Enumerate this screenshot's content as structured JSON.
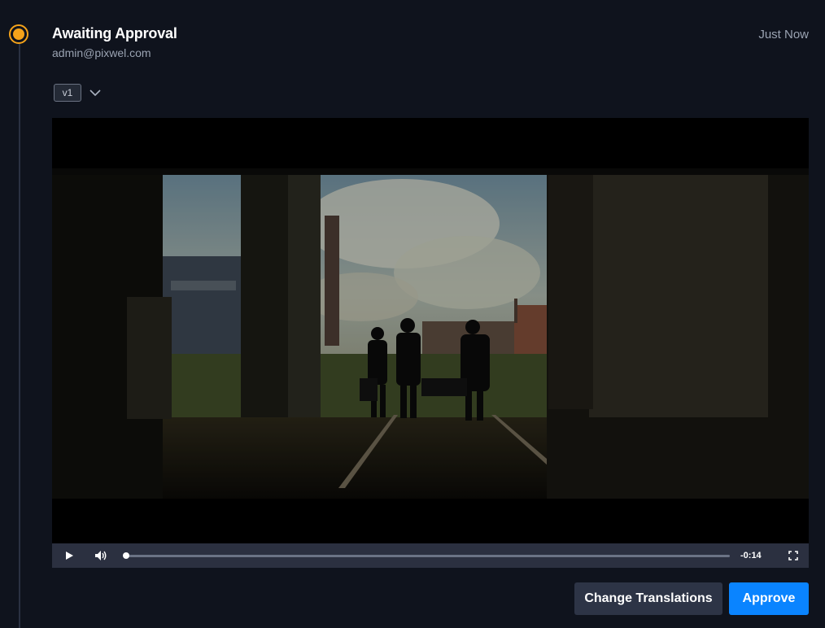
{
  "entry": {
    "status_title": "Awaiting Approval",
    "author": "admin@pixwel.com",
    "timestamp": "Just Now",
    "status_color": "#f5a31a"
  },
  "version": {
    "selected": "v1"
  },
  "player": {
    "remaining_time": "-0:14",
    "progress": 0.0
  },
  "actions": {
    "change_translations_label": "Change Translations",
    "approve_label": "Approve",
    "approve_color": "#0a84ff"
  },
  "icons": [
    "status-dot-icon",
    "chevron-down-icon",
    "play-icon",
    "volume-icon",
    "fullscreen-icon"
  ]
}
